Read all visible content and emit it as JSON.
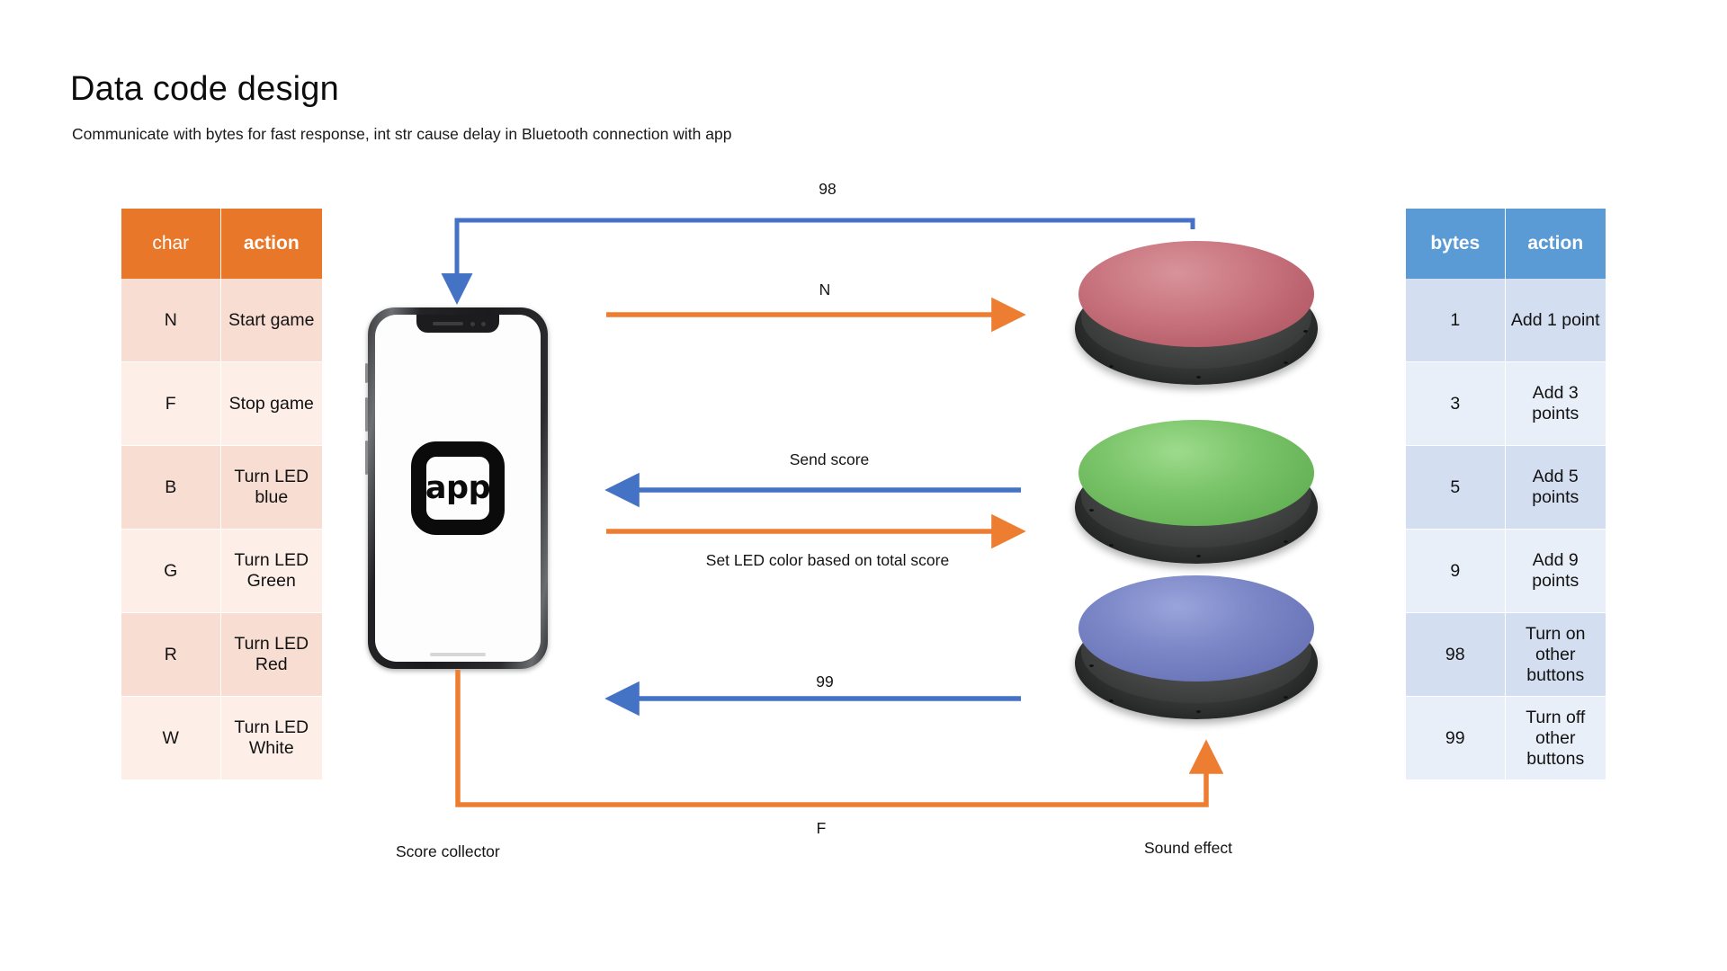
{
  "header": {
    "title": "Data code design",
    "subtitle": "Communicate with bytes for fast response, int str cause delay in Bluetooth connection with app"
  },
  "colors": {
    "orange_header": "#e8772a",
    "orange_row_a": "#f8ddd2",
    "orange_row_b": "#fdeee8",
    "blue_header": "#5b9bd5",
    "blue_row_a": "#d3def0",
    "blue_row_b": "#e9eff8",
    "arrow_blue": "#4472c4",
    "arrow_orange": "#ed7d31",
    "button_red": "#c9757f",
    "button_green": "#79c368",
    "button_blue": "#7a86c6"
  },
  "char_table": {
    "name": "char-action-table",
    "headers": [
      "char",
      "action"
    ],
    "rows": [
      {
        "char": "N",
        "action": "Start game"
      },
      {
        "char": "F",
        "action": "Stop game"
      },
      {
        "char": "B",
        "action": "Turn LED blue"
      },
      {
        "char": "G",
        "action": "Turn LED Green"
      },
      {
        "char": "R",
        "action": "Turn LED Red"
      },
      {
        "char": "W",
        "action": "Turn LED White"
      }
    ]
  },
  "bytes_table": {
    "name": "bytes-action-table",
    "headers": [
      "bytes",
      "action"
    ],
    "rows": [
      {
        "bytes": "1",
        "action": "Add 1 point"
      },
      {
        "bytes": "3",
        "action": "Add 3 points"
      },
      {
        "bytes": "5",
        "action": "Add 5 points"
      },
      {
        "bytes": "9",
        "action": "Add 9 points"
      },
      {
        "bytes": "98",
        "action": "Turn on other buttons"
      },
      {
        "bytes": "99",
        "action": "Turn off other buttons"
      }
    ]
  },
  "phone": {
    "app_icon_label": "app",
    "caption": "Score collector"
  },
  "buttons_device": {
    "caption": "Sound effect"
  },
  "flows": [
    {
      "id": "flow-98",
      "label": "98",
      "color": "#4472c4",
      "direction": "device-to-phone"
    },
    {
      "id": "flow-N",
      "label": "N",
      "color": "#ed7d31",
      "direction": "phone-to-device"
    },
    {
      "id": "flow-send-score",
      "label": "Send score",
      "color": "#4472c4",
      "direction": "device-to-phone"
    },
    {
      "id": "flow-set-led",
      "label": "Set LED color based on total score",
      "color": "#ed7d31",
      "direction": "phone-to-device"
    },
    {
      "id": "flow-99",
      "label": "99",
      "color": "#4472c4",
      "direction": "device-to-phone"
    },
    {
      "id": "flow-F",
      "label": "F",
      "color": "#ed7d31",
      "direction": "phone-to-device"
    }
  ]
}
